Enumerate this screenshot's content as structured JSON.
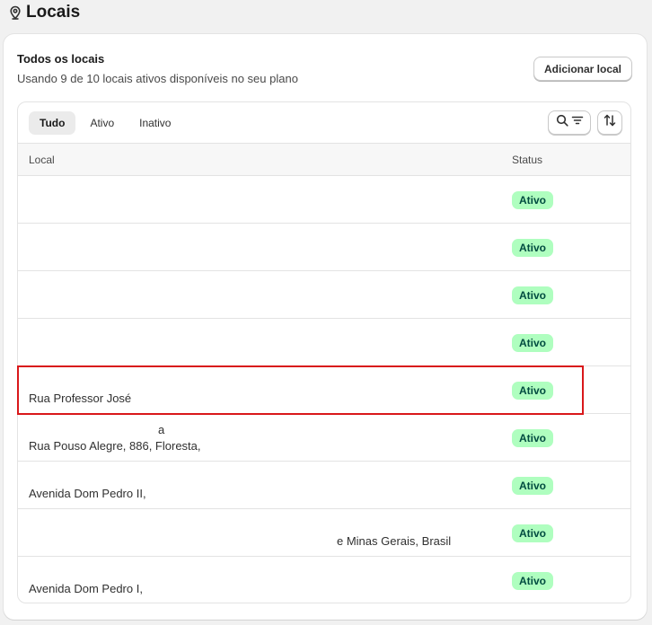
{
  "page": {
    "title": "Locais"
  },
  "card": {
    "title": "Todos os locais",
    "subtitle": "Usando 9 de 10 locais ativos disponíveis no seu plano",
    "add_button": "Adicionar local"
  },
  "tabs": [
    {
      "label": "Tudo",
      "active": true
    },
    {
      "label": "Ativo",
      "active": false
    },
    {
      "label": "Inativo",
      "active": false
    }
  ],
  "table": {
    "columns": {
      "local": "Local",
      "status": "Status"
    },
    "rows": [
      {
        "line1": "",
        "line2": "",
        "status": "Ativo"
      },
      {
        "line1": "",
        "line2": "",
        "status": "Ativo"
      },
      {
        "line1": "",
        "line2": "",
        "status": "Ativo"
      },
      {
        "line1": "",
        "line2": "",
        "status": "Ativo"
      },
      {
        "line1": "",
        "line2": "Rua Professor José",
        "status": "Ativo"
      },
      {
        "line1": "a",
        "line2": "Rua Pouso Alegre, 886, Floresta,",
        "status": "Ativo"
      },
      {
        "line1": "",
        "line2": "Avenida Dom Pedro II,",
        "status": "Ativo"
      },
      {
        "line1": "",
        "line2": "e Minas Gerais, Brasil",
        "status": "Ativo"
      },
      {
        "line1": "",
        "line2": "Avenida Dom Pedro I,",
        "status": "Ativo"
      }
    ]
  },
  "icons": {
    "title_icon": "location-pin-icon",
    "search_icon": "search-icon",
    "filter_icon": "filter-lines-icon",
    "sort_icon": "sort-arrows-icon"
  },
  "colors": {
    "badge_bg": "#affebf",
    "badge_text": "#014b40",
    "highlight": "#d9181a"
  }
}
